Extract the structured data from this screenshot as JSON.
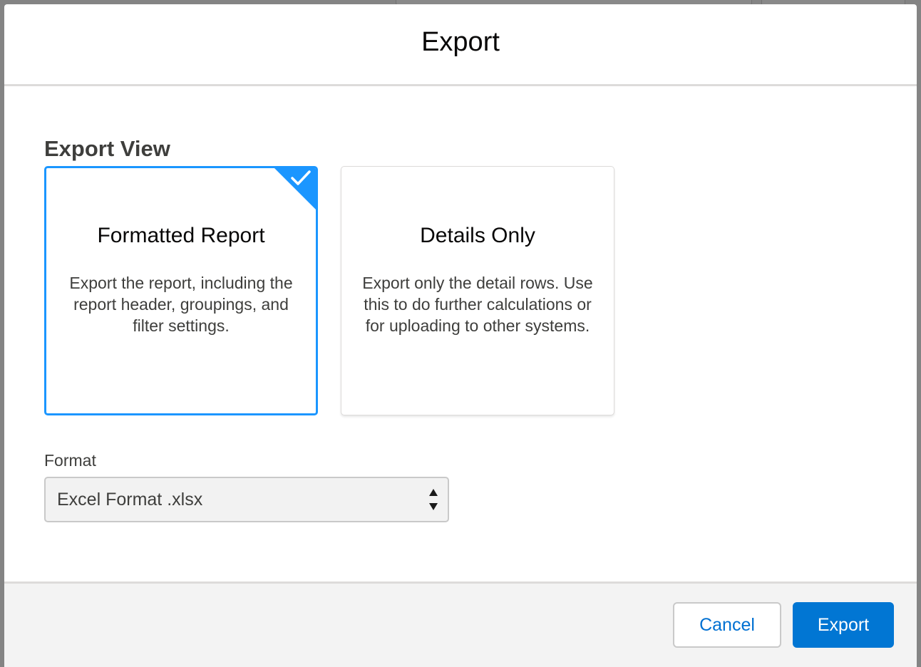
{
  "modal": {
    "title": "Export"
  },
  "export_view": {
    "heading": "Export View",
    "options": [
      {
        "title": "Formatted Report",
        "description": "Export the report, including the report header, groupings, and filter settings.",
        "selected": true
      },
      {
        "title": "Details Only",
        "description": "Export only the detail rows. Use this to do further calculations or for uploading to other systems.",
        "selected": false
      }
    ]
  },
  "format": {
    "label": "Format",
    "selected_value": "Excel Format .xlsx"
  },
  "footer": {
    "cancel_label": "Cancel",
    "export_label": "Export"
  },
  "colors": {
    "accent": "#1b96ff",
    "brand_button": "#0176d3",
    "link_text": "#0070d2"
  },
  "icons": {
    "selected_check": "checkmark-icon",
    "select_arrows": "up-down-arrows-icon"
  }
}
